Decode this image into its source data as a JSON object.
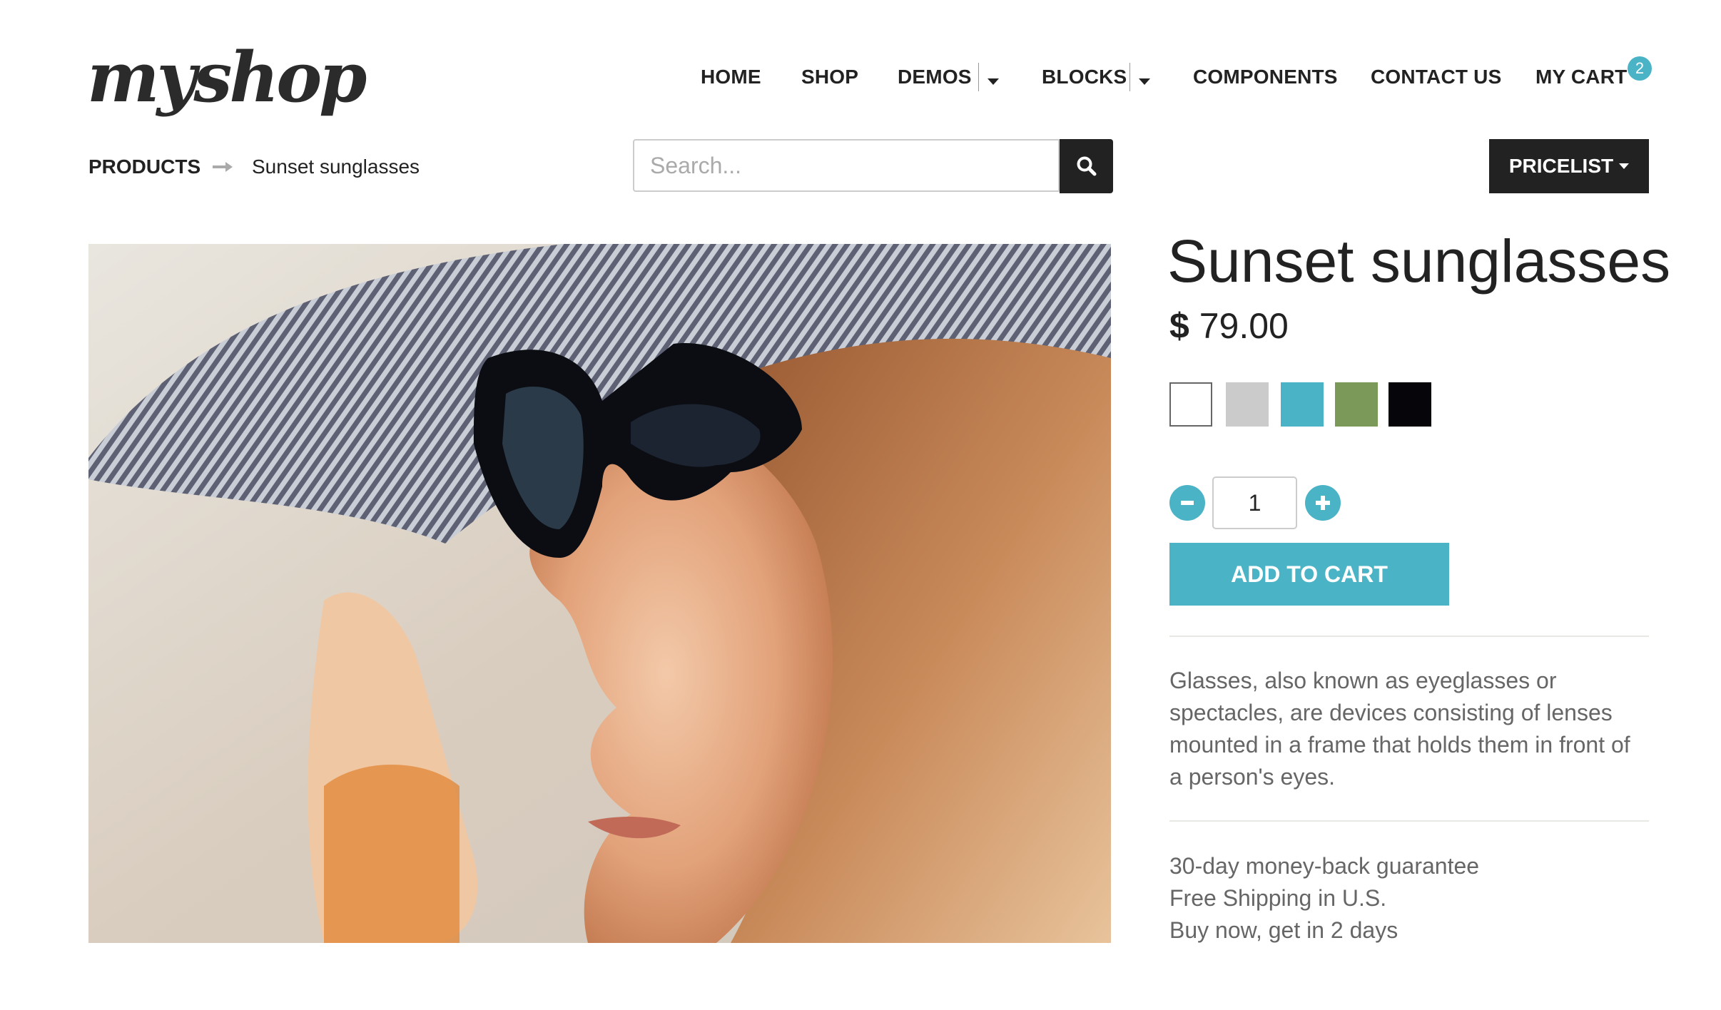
{
  "logo": "myshop",
  "nav": {
    "items": [
      "HOME",
      "SHOP",
      "DEMOS",
      "BLOCKS",
      "COMPONENTS",
      "CONTACT US",
      "MY CART"
    ],
    "cart_count": "2"
  },
  "breadcrumb": {
    "parent": "PRODUCTS",
    "current": "Sunset sunglasses"
  },
  "search": {
    "placeholder": "Search..."
  },
  "pricelist_label": "PRICELIST",
  "product": {
    "title": "Sunset sunglasses",
    "currency": "$",
    "price": "79.00",
    "colors": [
      "#ffffff",
      "#cbcbcb",
      "#4ab3c6",
      "#7b9a59",
      "#05050a"
    ],
    "quantity": "1",
    "add_to_cart": "ADD TO CART",
    "description": "Glasses, also known as eyeglasses or spectacles, are devices consisting of lenses mounted in a frame that holds them in front of a person's eyes.",
    "features": [
      "30-day money-back guarantee",
      "Free Shipping in U.S.",
      "Buy now, get in 2 days"
    ]
  },
  "accent_color": "#4ab3c6"
}
